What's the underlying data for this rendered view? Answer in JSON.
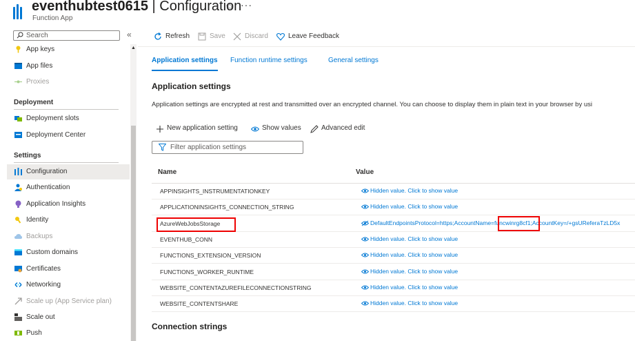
{
  "header": {
    "resource_name": "eventhubtest0615",
    "separator": "|",
    "blade_title": "Configuration",
    "resource_type": "Function App",
    "star_icon": "star-icon",
    "more_icon": "more-icon"
  },
  "sidebar": {
    "search_placeholder": "Search",
    "collapse_glyph": "«",
    "items_top": [
      {
        "label": "App keys",
        "icon": "key-icon",
        "disabled": false
      },
      {
        "label": "App files",
        "icon": "files-icon",
        "disabled": false
      },
      {
        "label": "Proxies",
        "icon": "proxies-icon",
        "disabled": true
      }
    ],
    "deployment_header": "Deployment",
    "deployment_items": [
      {
        "label": "Deployment slots",
        "icon": "slots-icon"
      },
      {
        "label": "Deployment Center",
        "icon": "deployment-center-icon"
      }
    ],
    "settings_header": "Settings",
    "settings_items": [
      {
        "label": "Configuration",
        "icon": "configuration-icon",
        "selected": true,
        "disabled": false
      },
      {
        "label": "Authentication",
        "icon": "authentication-icon",
        "selected": false,
        "disabled": false
      },
      {
        "label": "Application Insights",
        "icon": "insights-icon",
        "selected": false,
        "disabled": false
      },
      {
        "label": "Identity",
        "icon": "identity-icon",
        "selected": false,
        "disabled": false
      },
      {
        "label": "Backups",
        "icon": "backups-icon",
        "selected": false,
        "disabled": true
      },
      {
        "label": "Custom domains",
        "icon": "domains-icon",
        "selected": false,
        "disabled": false
      },
      {
        "label": "Certificates",
        "icon": "certificates-icon",
        "selected": false,
        "disabled": false
      },
      {
        "label": "Networking",
        "icon": "networking-icon",
        "selected": false,
        "disabled": false
      },
      {
        "label": "Scale up (App Service plan)",
        "icon": "scale-up-icon",
        "selected": false,
        "disabled": true
      },
      {
        "label": "Scale out",
        "icon": "scale-out-icon",
        "selected": false,
        "disabled": false
      },
      {
        "label": "Push",
        "icon": "push-icon",
        "selected": false,
        "disabled": false
      }
    ]
  },
  "toolbar": {
    "refresh": "Refresh",
    "save": "Save",
    "discard": "Discard",
    "feedback": "Leave Feedback"
  },
  "tabs": [
    {
      "label": "Application settings",
      "active": true
    },
    {
      "label": "Function runtime settings",
      "active": false
    },
    {
      "label": "General settings",
      "active": false
    }
  ],
  "main": {
    "section_title": "Application settings",
    "description": "Application settings are encrypted at rest and transmitted over an encrypted channel. You can choose to display them in plain text in your browser by usi",
    "new_setting": "New application setting",
    "show_values": "Show values",
    "advanced_edit": "Advanced edit",
    "filter_placeholder": "Filter application settings",
    "col_name": "Name",
    "col_value": "Value",
    "rows": [
      {
        "name": "APPINSIGHTS_INSTRUMENTATIONKEY",
        "value": "Hidden value. Click to show value"
      },
      {
        "name": "APPLICATIONINSIGHTS_CONNECTION_STRING",
        "value": "Hidden value. Click to show value"
      },
      {
        "name": "AzureWebJobsStorage",
        "value": "DefaultEndpointsProtocol=https;AccountName=funcwinrg8cf1;AccountKey=/+gsUReferaTzLD5x",
        "highlighted": true
      },
      {
        "name": "EVENTHUB_CONN",
        "value": "Hidden value. Click to show value"
      },
      {
        "name": "FUNCTIONS_EXTENSION_VERSION",
        "value": "Hidden value. Click to show value"
      },
      {
        "name": "FUNCTIONS_WORKER_RUNTIME",
        "value": "Hidden value. Click to show value"
      },
      {
        "name": "WEBSITE_CONTENTAZUREFILECONNECTIONSTRING",
        "value": "Hidden value. Click to show value"
      },
      {
        "name": "WEBSITE_CONTENTSHARE",
        "value": "Hidden value. Click to show value"
      }
    ],
    "connection_strings_title": "Connection strings"
  },
  "colors": {
    "accent": "#0078d4",
    "highlight": "#e00000",
    "selected_bg": "#edebe9"
  }
}
